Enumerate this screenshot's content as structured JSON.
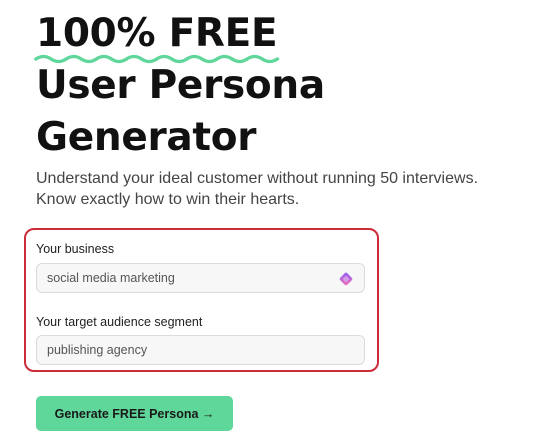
{
  "hero": {
    "highlight": "100% FREE",
    "line_2": "User Persona",
    "line_3": "Generator"
  },
  "subtitle": {
    "line_1": "Understand your ideal customer without running 50 interviews.",
    "line_2": "Know exactly how to win their hearts."
  },
  "form": {
    "business": {
      "label": "Your business",
      "value": "social media marketing",
      "icon": "assistant-sparkle-icon"
    },
    "audience": {
      "label": "Your target audience segment",
      "value": "publishing agency"
    }
  },
  "cta": {
    "label": "Generate FREE Persona →"
  },
  "colors": {
    "highlight_underline": "#5fd69a",
    "button": "#5fd69a",
    "form_outline": "#cc2b3a",
    "icon_gradient": [
      "#8a5cf6",
      "#f472b6"
    ]
  }
}
